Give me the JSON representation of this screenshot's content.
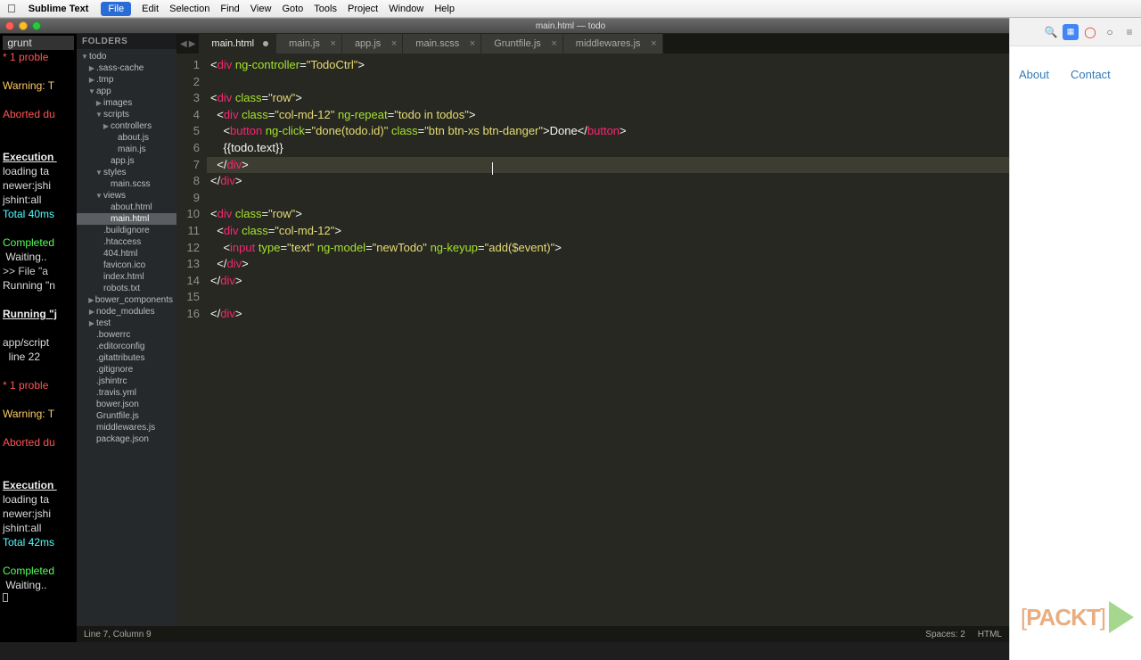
{
  "menubar": {
    "app_name": "Sublime Text",
    "items": [
      "File",
      "Edit",
      "Selection",
      "Find",
      "View",
      "Goto",
      "Tools",
      "Project",
      "Window",
      "Help"
    ],
    "active_index": 0
  },
  "window": {
    "title": "main.html — todo"
  },
  "terminal": {
    "lines": [
      {
        "cls": "grunt",
        "text": " grunt "
      },
      {
        "cls": "err",
        "text": "* 1 proble"
      },
      {
        "cls": "",
        "text": ""
      },
      {
        "cls": "warn",
        "text": "Warning: T"
      },
      {
        "cls": "",
        "text": ""
      },
      {
        "cls": "err",
        "text": "Aborted du"
      },
      {
        "cls": "",
        "text": ""
      },
      {
        "cls": "",
        "text": ""
      },
      {
        "cls": "run",
        "text": "Execution "
      },
      {
        "cls": "",
        "text": "loading ta"
      },
      {
        "cls": "",
        "text": "newer:jshi"
      },
      {
        "cls": "",
        "text": "jshint:all"
      },
      {
        "cls": "ok",
        "text": "Total 40ms"
      },
      {
        "cls": "",
        "text": ""
      },
      {
        "cls": "ok2",
        "text": "Completed "
      },
      {
        "cls": "",
        "text": " Waiting.."
      },
      {
        "cls": "file",
        "text": ">> File \"a"
      },
      {
        "cls": "",
        "text": "Running \"n"
      },
      {
        "cls": "",
        "text": ""
      },
      {
        "cls": "run",
        "text": "Running \"j"
      },
      {
        "cls": "",
        "text": ""
      },
      {
        "cls": "",
        "text": "app/script"
      },
      {
        "cls": "",
        "text": "  line 22"
      },
      {
        "cls": "",
        "text": ""
      },
      {
        "cls": "err",
        "text": "* 1 proble"
      },
      {
        "cls": "",
        "text": ""
      },
      {
        "cls": "warn",
        "text": "Warning: T"
      },
      {
        "cls": "",
        "text": ""
      },
      {
        "cls": "err",
        "text": "Aborted du"
      },
      {
        "cls": "",
        "text": ""
      },
      {
        "cls": "",
        "text": ""
      },
      {
        "cls": "run",
        "text": "Execution "
      },
      {
        "cls": "",
        "text": "loading ta"
      },
      {
        "cls": "",
        "text": "newer:jshi"
      },
      {
        "cls": "",
        "text": "jshint:all"
      },
      {
        "cls": "ok",
        "text": "Total 42ms"
      },
      {
        "cls": "",
        "text": ""
      },
      {
        "cls": "ok2",
        "text": "Completed "
      },
      {
        "cls": "",
        "text": " Waiting.."
      }
    ]
  },
  "sidebar": {
    "header": "FOLDERS",
    "tree": [
      {
        "name": "todo",
        "type": "folder",
        "open": true,
        "indent": 0
      },
      {
        "name": ".sass-cache",
        "type": "folder",
        "open": false,
        "indent": 1
      },
      {
        "name": ".tmp",
        "type": "folder",
        "open": false,
        "indent": 1
      },
      {
        "name": "app",
        "type": "folder",
        "open": true,
        "indent": 1
      },
      {
        "name": "images",
        "type": "folder",
        "open": false,
        "indent": 2
      },
      {
        "name": "scripts",
        "type": "folder",
        "open": true,
        "indent": 2
      },
      {
        "name": "controllers",
        "type": "folder",
        "open": false,
        "indent": 3
      },
      {
        "name": "about.js",
        "type": "file",
        "indent": 4
      },
      {
        "name": "main.js",
        "type": "file",
        "indent": 4
      },
      {
        "name": "app.js",
        "type": "file",
        "indent": 3
      },
      {
        "name": "styles",
        "type": "folder",
        "open": true,
        "indent": 2
      },
      {
        "name": "main.scss",
        "type": "file",
        "indent": 3
      },
      {
        "name": "views",
        "type": "folder",
        "open": true,
        "indent": 2
      },
      {
        "name": "about.html",
        "type": "file",
        "indent": 3
      },
      {
        "name": "main.html",
        "type": "file",
        "indent": 3,
        "active": true
      },
      {
        "name": ".buildignore",
        "type": "file",
        "indent": 2
      },
      {
        "name": ".htaccess",
        "type": "file",
        "indent": 2
      },
      {
        "name": "404.html",
        "type": "file",
        "indent": 2
      },
      {
        "name": "favicon.ico",
        "type": "file",
        "indent": 2
      },
      {
        "name": "index.html",
        "type": "file",
        "indent": 2
      },
      {
        "name": "robots.txt",
        "type": "file",
        "indent": 2
      },
      {
        "name": "bower_components",
        "type": "folder",
        "open": false,
        "indent": 1
      },
      {
        "name": "node_modules",
        "type": "folder",
        "open": false,
        "indent": 1
      },
      {
        "name": "test",
        "type": "folder",
        "open": false,
        "indent": 1
      },
      {
        "name": ".bowerrc",
        "type": "file",
        "indent": 1
      },
      {
        "name": ".editorconfig",
        "type": "file",
        "indent": 1
      },
      {
        "name": ".gitattributes",
        "type": "file",
        "indent": 1
      },
      {
        "name": ".gitignore",
        "type": "file",
        "indent": 1
      },
      {
        "name": ".jshintrc",
        "type": "file",
        "indent": 1
      },
      {
        "name": ".travis.yml",
        "type": "file",
        "indent": 1
      },
      {
        "name": "bower.json",
        "type": "file",
        "indent": 1
      },
      {
        "name": "Gruntfile.js",
        "type": "file",
        "indent": 1
      },
      {
        "name": "middlewares.js",
        "type": "file",
        "indent": 1
      },
      {
        "name": "package.json",
        "type": "file",
        "indent": 1
      }
    ]
  },
  "tabs": [
    {
      "label": "main.html",
      "active": true,
      "dirty": true
    },
    {
      "label": "main.js",
      "active": false,
      "dirty": false
    },
    {
      "label": "app.js",
      "active": false,
      "dirty": false
    },
    {
      "label": "main.scss",
      "active": false,
      "dirty": false
    },
    {
      "label": "Gruntfile.js",
      "active": false,
      "dirty": false
    },
    {
      "label": "middlewares.js",
      "active": false,
      "dirty": false
    }
  ],
  "code": {
    "active_line": 7,
    "lines": [
      {
        "n": 1,
        "tokens": [
          [
            "pun",
            "<"
          ],
          [
            "tag",
            "div"
          ],
          [
            "ws",
            " "
          ],
          [
            "attr",
            "ng-controller"
          ],
          [
            "pun",
            "="
          ],
          [
            "str",
            "\"TodoCtrl\""
          ],
          [
            "pun",
            ">"
          ]
        ]
      },
      {
        "n": 2,
        "tokens": []
      },
      {
        "n": 3,
        "tokens": [
          [
            "pun",
            "<"
          ],
          [
            "tag",
            "div"
          ],
          [
            "ws",
            " "
          ],
          [
            "attr",
            "class"
          ],
          [
            "pun",
            "="
          ],
          [
            "str",
            "\"row\""
          ],
          [
            "pun",
            ">"
          ]
        ]
      },
      {
        "n": 4,
        "tokens": [
          [
            "ws",
            "  "
          ],
          [
            "pun",
            "<"
          ],
          [
            "tag",
            "div"
          ],
          [
            "ws",
            " "
          ],
          [
            "attr",
            "class"
          ],
          [
            "pun",
            "="
          ],
          [
            "str",
            "\"col-md-12\""
          ],
          [
            "ws",
            " "
          ],
          [
            "attr",
            "ng-repeat"
          ],
          [
            "pun",
            "="
          ],
          [
            "str",
            "\"todo in todos\""
          ],
          [
            "pun",
            ">"
          ]
        ]
      },
      {
        "n": 5,
        "tokens": [
          [
            "ws",
            "    "
          ],
          [
            "pun",
            "<"
          ],
          [
            "tag",
            "button"
          ],
          [
            "ws",
            " "
          ],
          [
            "attr",
            "ng-click"
          ],
          [
            "pun",
            "="
          ],
          [
            "str",
            "\"done(todo.id)\""
          ],
          [
            "ws",
            " "
          ],
          [
            "attr",
            "class"
          ],
          [
            "pun",
            "="
          ],
          [
            "str",
            "\"btn btn-xs btn-danger\""
          ],
          [
            "pun",
            ">"
          ],
          [
            "ws",
            "Done"
          ],
          [
            "pun",
            "</"
          ],
          [
            "tag",
            "button"
          ],
          [
            "pun",
            ">"
          ]
        ]
      },
      {
        "n": 6,
        "tokens": [
          [
            "ws",
            "    {{todo.text}}"
          ]
        ]
      },
      {
        "n": 7,
        "tokens": [
          [
            "ws",
            "  "
          ],
          [
            "pun",
            "</"
          ],
          [
            "tag",
            "div"
          ],
          [
            "pun",
            ">"
          ]
        ]
      },
      {
        "n": 8,
        "tokens": [
          [
            "pun",
            "</"
          ],
          [
            "tag",
            "div"
          ],
          [
            "pun",
            ">"
          ]
        ]
      },
      {
        "n": 9,
        "tokens": []
      },
      {
        "n": 10,
        "tokens": [
          [
            "pun",
            "<"
          ],
          [
            "tag",
            "div"
          ],
          [
            "ws",
            " "
          ],
          [
            "attr",
            "class"
          ],
          [
            "pun",
            "="
          ],
          [
            "str",
            "\"row\""
          ],
          [
            "pun",
            ">"
          ]
        ]
      },
      {
        "n": 11,
        "tokens": [
          [
            "ws",
            "  "
          ],
          [
            "pun",
            "<"
          ],
          [
            "tag",
            "div"
          ],
          [
            "ws",
            " "
          ],
          [
            "attr",
            "class"
          ],
          [
            "pun",
            "="
          ],
          [
            "str",
            "\"col-md-12\""
          ],
          [
            "pun",
            ">"
          ]
        ]
      },
      {
        "n": 12,
        "tokens": [
          [
            "ws",
            "    "
          ],
          [
            "pun",
            "<"
          ],
          [
            "tag",
            "input"
          ],
          [
            "ws",
            " "
          ],
          [
            "attr",
            "type"
          ],
          [
            "pun",
            "="
          ],
          [
            "str",
            "\"text\""
          ],
          [
            "ws",
            " "
          ],
          [
            "attr",
            "ng-model"
          ],
          [
            "pun",
            "="
          ],
          [
            "str",
            "\"newTodo\""
          ],
          [
            "ws",
            " "
          ],
          [
            "attr",
            "ng-keyup"
          ],
          [
            "pun",
            "="
          ],
          [
            "str",
            "\"add($event)\""
          ],
          [
            "pun",
            ">"
          ]
        ]
      },
      {
        "n": 13,
        "tokens": [
          [
            "ws",
            "  "
          ],
          [
            "pun",
            "</"
          ],
          [
            "tag",
            "div"
          ],
          [
            "pun",
            ">"
          ]
        ]
      },
      {
        "n": 14,
        "tokens": [
          [
            "pun",
            "</"
          ],
          [
            "tag",
            "div"
          ],
          [
            "pun",
            ">"
          ]
        ]
      },
      {
        "n": 15,
        "tokens": []
      },
      {
        "n": 16,
        "tokens": [
          [
            "pun",
            "</"
          ],
          [
            "tag",
            "div"
          ],
          [
            "pun",
            ">"
          ]
        ]
      }
    ]
  },
  "status": {
    "left": "Line 7, Column 9",
    "spaces": "Spaces: 2",
    "lang": "HTML"
  },
  "browser": {
    "nav": [
      "About",
      "Contact"
    ]
  },
  "logo": {
    "text": "[PACKT]"
  }
}
